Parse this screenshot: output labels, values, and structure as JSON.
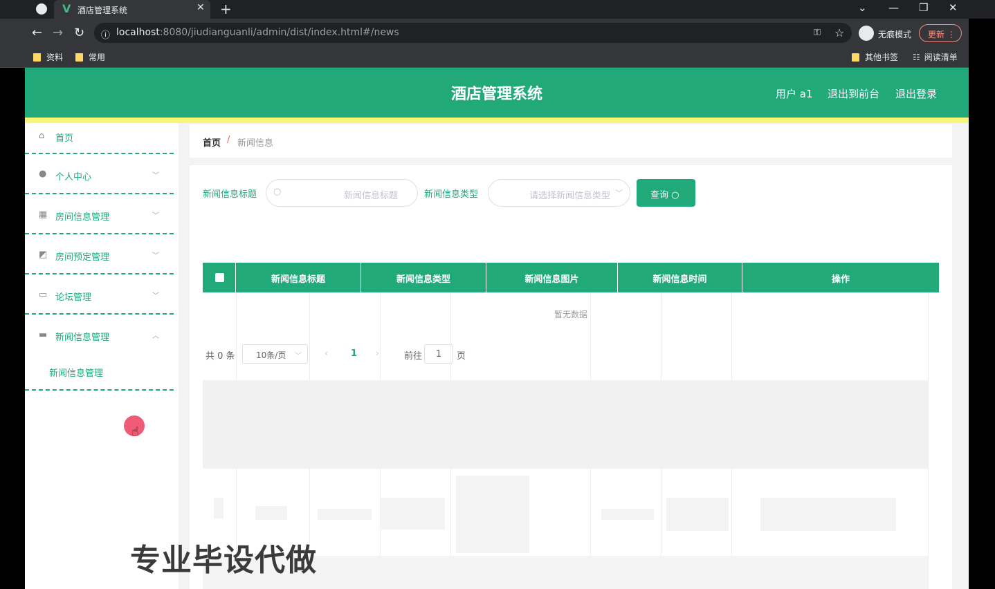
{
  "browser": {
    "tab_title": "酒店管理系统",
    "tab_close": "✕",
    "new_tab": "+",
    "url_host": "localhost",
    "url_path": ":8080/jiudianguanli/admin/dist/index.html#/news",
    "incognito_label": "无痕模式",
    "update_label": "更新",
    "bookmarks": [
      "资料",
      "常用"
    ],
    "other_bookmarks": "其他书签",
    "reading_list": "阅读清单"
  },
  "header": {
    "title": "酒店管理系统",
    "user": "用户 a1",
    "to_front": "退出到前台",
    "logout": "退出登录"
  },
  "sidebar": {
    "items": [
      {
        "label": "首页",
        "icon": "home-icon"
      },
      {
        "label": "个人中心",
        "icon": "user-icon"
      },
      {
        "label": "房间信息管理",
        "icon": "grid-icon"
      },
      {
        "label": "房间预定管理",
        "icon": "chart-icon"
      },
      {
        "label": "论坛管理",
        "icon": "chat-icon"
      },
      {
        "label": "新闻信息管理",
        "icon": "briefcase-icon"
      }
    ],
    "sub_item": "新闻信息管理"
  },
  "breadcrumb": {
    "home": "首页",
    "separator": "/",
    "current": "新闻信息"
  },
  "search": {
    "title_label": "新闻信息标题",
    "title_placeholder": "新闻信息标题",
    "type_label": "新闻信息类型",
    "type_placeholder": "请选择新闻信息类型",
    "query_button": "查询"
  },
  "table": {
    "columns": [
      "新闻信息标题",
      "新闻信息类型",
      "新闻信息图片",
      "新闻信息时间",
      "操作"
    ],
    "empty_text": "暂无数据"
  },
  "pagination": {
    "total": "共 0 条",
    "page_size": "10条/页",
    "current_page": "1",
    "goto_label": "前往",
    "goto_value": "1",
    "page_suffix": "页"
  },
  "watermark": "专业毕设代做",
  "colors": {
    "primary": "#21a97a",
    "header_stripe": "#f5f57a",
    "breadcrumb_separator": "#e6695b"
  }
}
